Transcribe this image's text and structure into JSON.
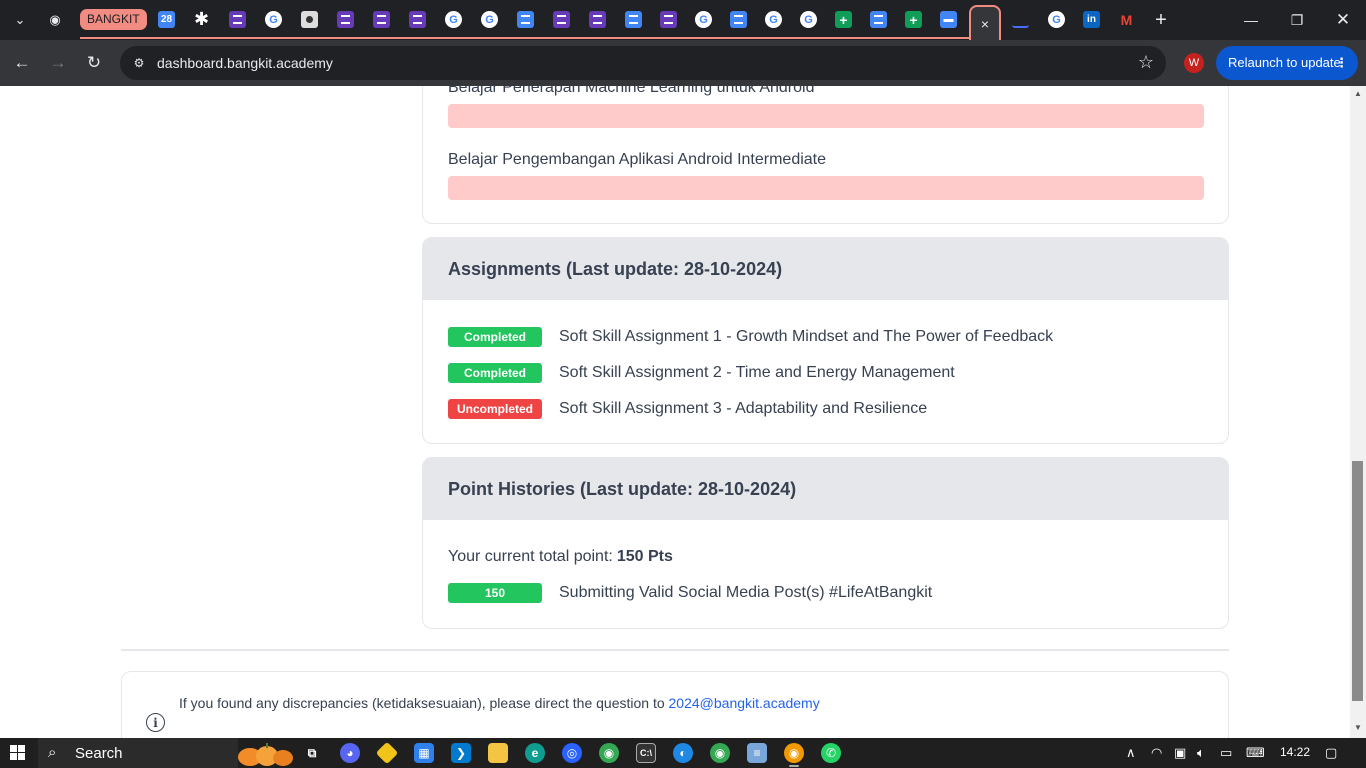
{
  "browser": {
    "tab_group_label": "BANGKIT",
    "active_tab_close": "×",
    "new_tab": "+",
    "url": "dashboard.bangkit.academy",
    "profile_initial": "W",
    "relaunch_label": "Relaunch to update",
    "relaunch_menu": "⋮"
  },
  "courses": {
    "item1_title": "Belajar Penerapan Machine Learning untuk Android",
    "item2_title": "Belajar Pengembangan Aplikasi Android Intermediate"
  },
  "assignments": {
    "heading": "Assignments (Last update: 28-10-2024)",
    "items": [
      {
        "status": "Completed",
        "title": "Soft Skill Assignment 1 - Growth Mindset and The Power of Feedback"
      },
      {
        "status": "Completed",
        "title": "Soft Skill Assignment 2 - Time and Energy Management"
      },
      {
        "status": "Uncompleted",
        "title": "Soft Skill Assignment 3 - Adaptability and Resilience"
      }
    ]
  },
  "points": {
    "heading": "Point Histories (Last update: 28-10-2024)",
    "total_label": "Your current total point:",
    "total_value": "150 Pts",
    "items": [
      {
        "points": "150",
        "title": "Submitting Valid Social Media Post(s) #LifeAtBangkit"
      }
    ]
  },
  "notice": {
    "text": "If you found any discrepancies (ketidaksesuaian), please direct the question to",
    "email": "2024@bangkit.academy"
  },
  "taskbar": {
    "search_label": "Search",
    "time": "14:22"
  },
  "colors": {
    "completed": "#22c55e",
    "uncompleted": "#ef4444",
    "progress_empty": "#fecaca",
    "link": "#2563eb",
    "relaunch": "#0b57d0"
  }
}
